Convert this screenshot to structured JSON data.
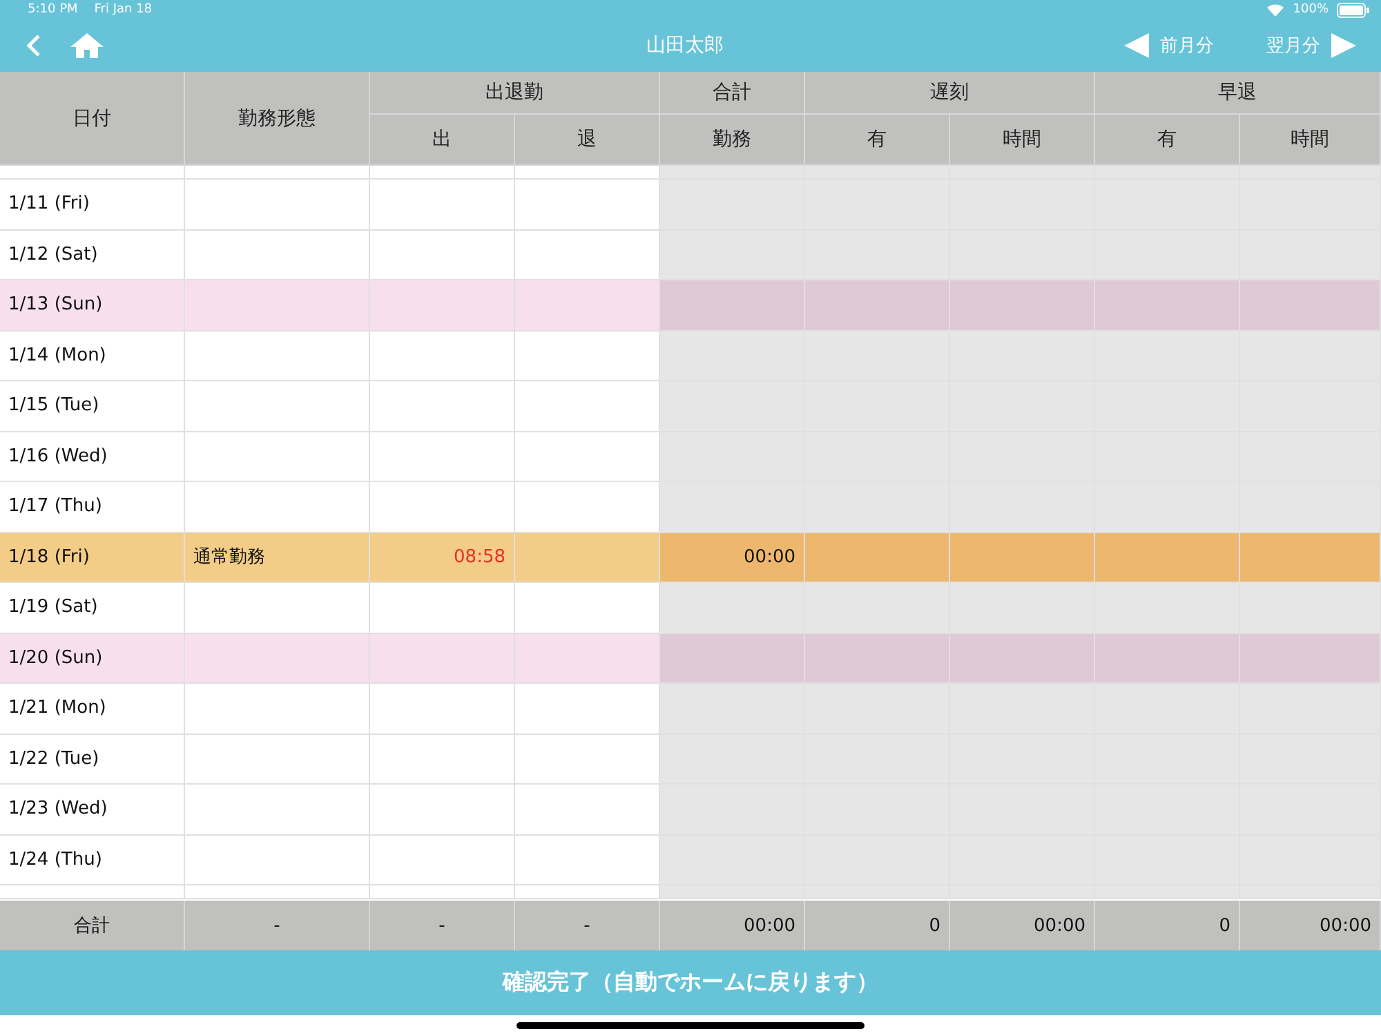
{
  "status_bar": {
    "time": "5:10 PM",
    "date": "Fri Jan 18",
    "battery": "100%"
  },
  "nav": {
    "title": "山田太郎",
    "prev": "前月分",
    "next": "翌月分"
  },
  "header": [
    {
      "label": "日付"
    },
    {
      "label": "勤務形態"
    },
    {
      "label": "出退勤",
      "sub": [
        "出",
        "退"
      ]
    },
    {
      "label": "合計",
      "sub": [
        "勤務"
      ]
    },
    {
      "label": "遅刻",
      "sub": [
        "有",
        "時間"
      ]
    },
    {
      "label": "早退",
      "sub": [
        "有",
        "時間"
      ]
    }
  ],
  "rows": [
    {
      "date": "1/11 (Fri)",
      "kind": "weekday"
    },
    {
      "date": "1/12 (Sat)",
      "kind": "weekday"
    },
    {
      "date": "1/13 (Sun)",
      "kind": "holiday"
    },
    {
      "date": "1/14 (Mon)",
      "kind": "weekday"
    },
    {
      "date": "1/15 (Tue)",
      "kind": "weekday"
    },
    {
      "date": "1/16 (Wed)",
      "kind": "weekday"
    },
    {
      "date": "1/17 (Thu)",
      "kind": "weekday"
    },
    {
      "date": "1/18 (Fri)",
      "kind": "today",
      "work_type": "通常勤務",
      "clock_in": "08:58",
      "total": "00:00"
    },
    {
      "date": "1/19 (Sat)",
      "kind": "weekday"
    },
    {
      "date": "1/20 (Sun)",
      "kind": "holiday"
    },
    {
      "date": "1/21 (Mon)",
      "kind": "weekday"
    },
    {
      "date": "1/22 (Tue)",
      "kind": "weekday"
    },
    {
      "date": "1/23 (Wed)",
      "kind": "weekday"
    },
    {
      "date": "1/24 (Thu)",
      "kind": "weekday"
    }
  ],
  "totals": {
    "label": "合計",
    "values": [
      "-",
      "-",
      "-",
      "00:00",
      "0",
      "00:00",
      "0",
      "00:00"
    ]
  },
  "confirm_button": "確認完了（自動でホームに戻ります）"
}
